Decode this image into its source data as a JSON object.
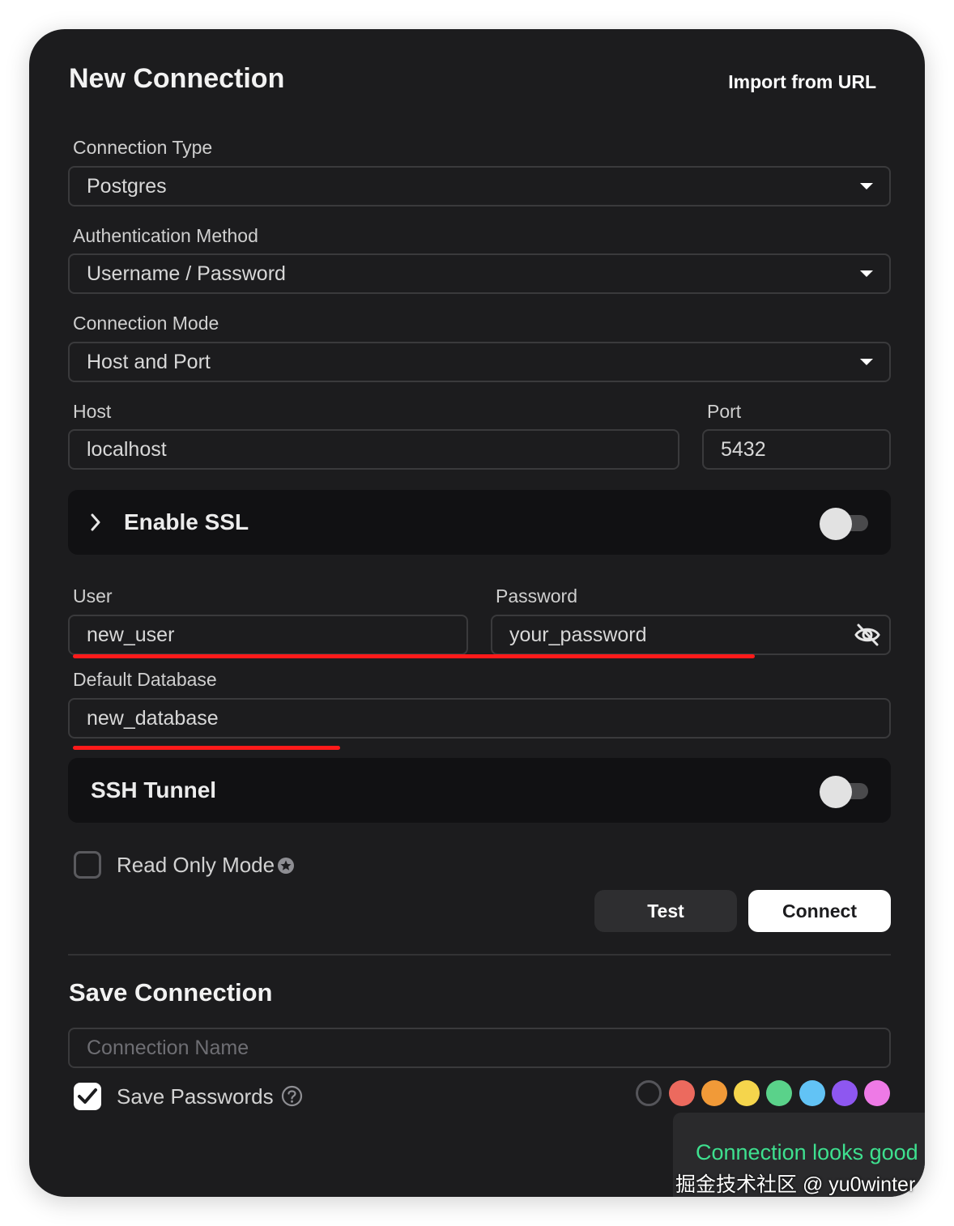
{
  "header": {
    "title": "New Connection",
    "import_label": "Import from URL"
  },
  "form": {
    "connection_type": {
      "label": "Connection Type",
      "value": "Postgres"
    },
    "auth_method": {
      "label": "Authentication Method",
      "value": "Username / Password"
    },
    "connection_mode": {
      "label": "Connection Mode",
      "value": "Host and Port"
    },
    "host": {
      "label": "Host",
      "value": "localhost"
    },
    "port": {
      "label": "Port",
      "value": "5432"
    },
    "ssl": {
      "label": "Enable SSL",
      "enabled": false
    },
    "user": {
      "label": "User",
      "value": "new_user"
    },
    "password": {
      "label": "Password",
      "value": "your_password"
    },
    "default_database": {
      "label": "Default Database",
      "value": "new_database"
    },
    "ssh": {
      "label": "SSH Tunnel",
      "enabled": false
    },
    "read_only": {
      "label": "Read Only Mode",
      "checked": false
    }
  },
  "actions": {
    "test_label": "Test",
    "connect_label": "Connect"
  },
  "save": {
    "title": "Save Connection",
    "name_placeholder": "Connection Name",
    "save_passwords_label": "Save Passwords",
    "save_passwords_checked": true,
    "colors": [
      "none",
      "#ec6a5e",
      "#f19a38",
      "#f5d54c",
      "#5ad28a",
      "#62c3f5",
      "#8e57f0",
      "#ee7ae6"
    ]
  },
  "toast": {
    "message": "Connection looks good"
  },
  "watermark": "掘金技术社区 @ yu0winter",
  "icons": {
    "caret": "caret-down-icon",
    "chevron": "chevron-right-icon",
    "eye": "eye-off-icon",
    "help": "help-circle-icon",
    "star": "star-badge-icon"
  }
}
